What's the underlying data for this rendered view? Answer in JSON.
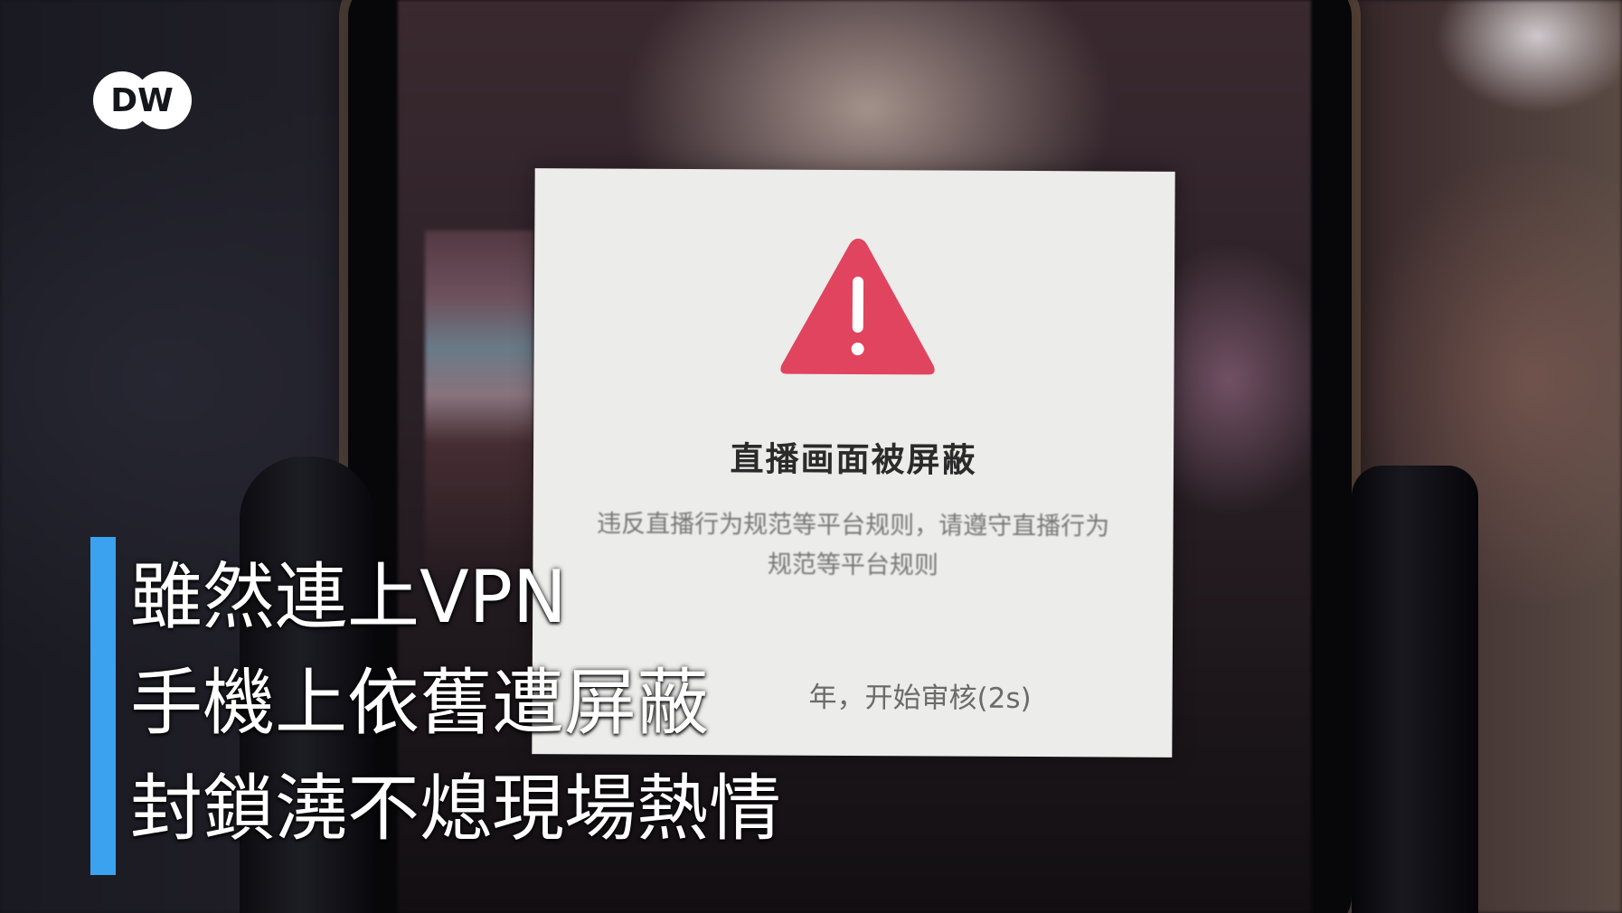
{
  "logo": {
    "text": "DW"
  },
  "dialog": {
    "icon": "warning-triangle-icon",
    "icon_color": "#e0445f",
    "title": "直播画面被屏蔽",
    "message": "违反直播行为规范等平台规则，请遵守直播行为规范等平台规则",
    "footer": "年，开始审核(2s)"
  },
  "subtitle": {
    "bar_color": "#3ba2f0",
    "lines": [
      "雖然連上VPN",
      "手機上依舊遭屏蔽",
      "封鎖澆不熄現場熱情"
    ]
  }
}
